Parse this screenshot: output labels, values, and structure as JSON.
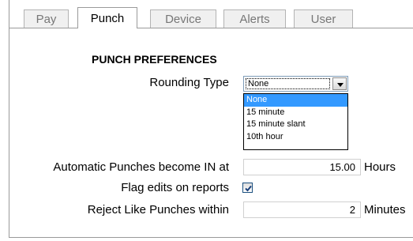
{
  "tabs": [
    {
      "label": "Pay",
      "active": false
    },
    {
      "label": "Punch",
      "active": true
    },
    {
      "label": "Device",
      "active": false
    },
    {
      "label": "Alerts",
      "active": false
    },
    {
      "label": "User",
      "active": false
    }
  ],
  "section": {
    "heading": "PUNCH PREFERENCES"
  },
  "rounding": {
    "label": "Rounding Type",
    "selected": "None",
    "options": [
      "None",
      "15 minute",
      "15 minute slant",
      "10th hour"
    ]
  },
  "auto_punch": {
    "label": "Automatic Punches become IN at",
    "value": "15.00",
    "unit": "Hours"
  },
  "flag_edits": {
    "label": "Flag edits on reports",
    "checked": true
  },
  "reject": {
    "label": "Reject Like Punches within",
    "value": "2",
    "unit": "Minutes"
  },
  "colors": {
    "selection": "#3399ff",
    "checkbox_border": "#1c5180"
  },
  "icons": {
    "dropdown": "chevron-down-icon",
    "check": "checkmark-icon"
  }
}
